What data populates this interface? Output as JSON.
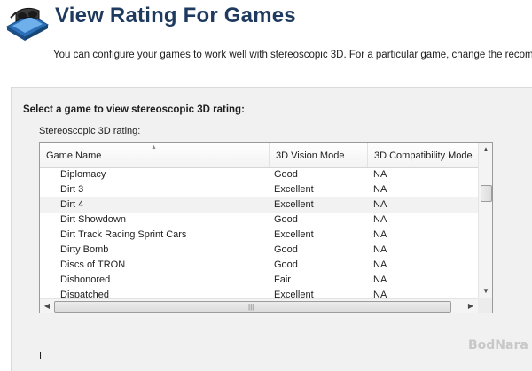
{
  "header": {
    "title": "View Rating For Games",
    "logo_icon": "stereoscopic-3d-glasses-icon"
  },
  "description": "You can configure your games to work well with stereoscopic 3D. For a particular game, change the recommended",
  "section": {
    "select_label": "Select a game to view stereoscopic 3D rating:",
    "rating_label": "Stereoscopic 3D rating:"
  },
  "table": {
    "columns": [
      "Game Name",
      "3D Vision Mode",
      "3D Compatibility Mode"
    ],
    "sort_column": "Game Name",
    "rows": [
      {
        "name": "Diplomacy",
        "vision": "Good",
        "compat": "NA"
      },
      {
        "name": "Dirt 3",
        "vision": "Excellent",
        "compat": "NA"
      },
      {
        "name": "Dirt 4",
        "vision": "Excellent",
        "compat": "NA"
      },
      {
        "name": "Dirt Showdown",
        "vision": "Good",
        "compat": "NA"
      },
      {
        "name": "Dirt Track Racing Sprint Cars",
        "vision": "Excellent",
        "compat": "NA"
      },
      {
        "name": "Dirty Bomb",
        "vision": "Good",
        "compat": "NA"
      },
      {
        "name": "Discs of TRON",
        "vision": "Good",
        "compat": "NA"
      },
      {
        "name": "Dishonored",
        "vision": "Fair",
        "compat": "NA"
      },
      {
        "name": "Dispatched",
        "vision": "Excellent",
        "compat": "NA"
      }
    ],
    "scroll_icons": {
      "up": "▲",
      "down": "▼",
      "left": "◀",
      "right": "▶",
      "grip": "|||"
    }
  },
  "watermark": "BodNara",
  "footer_partial_text": "I"
}
